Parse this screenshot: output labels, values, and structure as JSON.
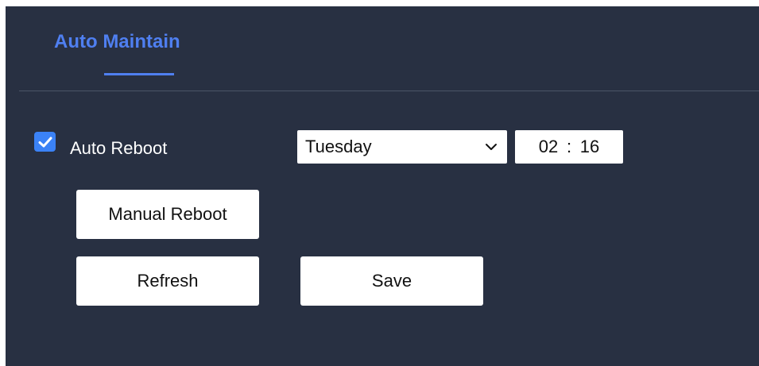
{
  "tabs": {
    "active_label": "Auto Maintain"
  },
  "auto_reboot": {
    "checked": true,
    "label": "Auto Reboot",
    "day": "Tuesday",
    "hour": "02",
    "separator": ":",
    "minute": "16"
  },
  "buttons": {
    "manual_reboot": "Manual Reboot",
    "refresh": "Refresh",
    "save": "Save"
  },
  "colors": {
    "panel_background": "#283042",
    "accent": "#4f7ff0",
    "checkbox": "#3b82f6"
  },
  "icons": {
    "checkbox_mark": "check-icon",
    "select_arrow": "chevron-down-icon"
  }
}
